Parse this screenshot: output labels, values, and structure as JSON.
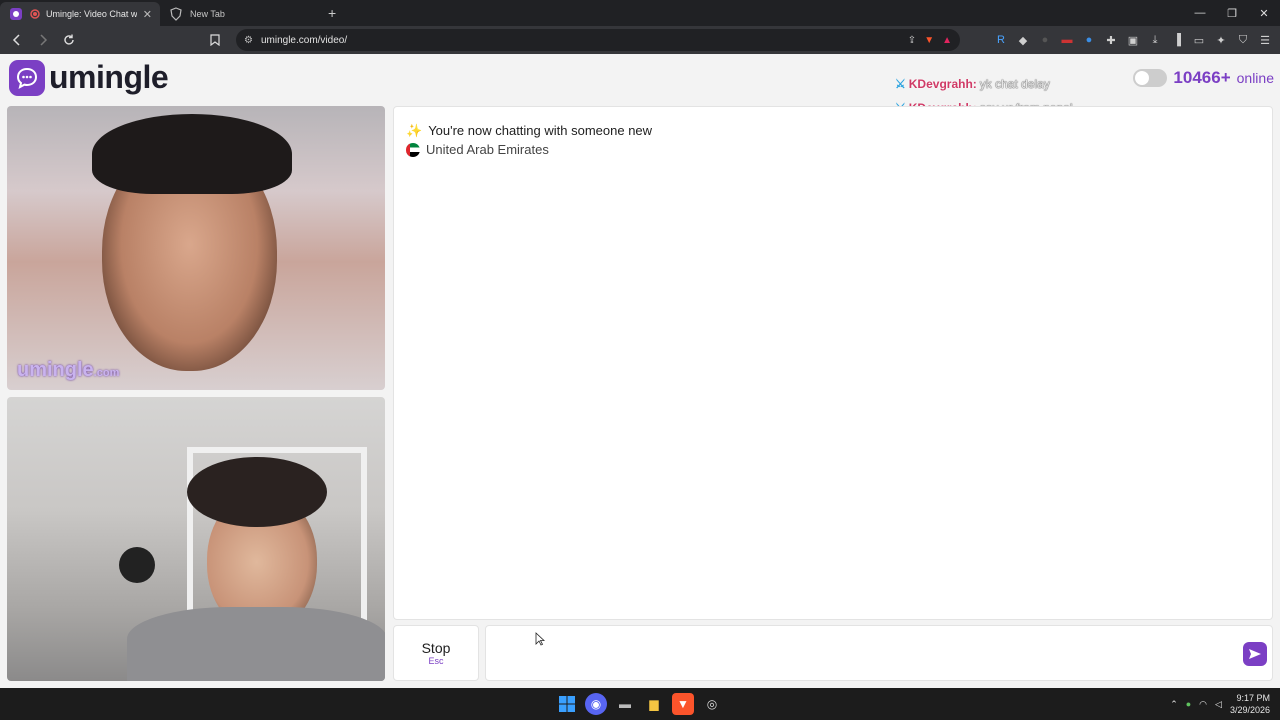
{
  "browser": {
    "tabs": [
      {
        "title": "Umingle: Video Chat with Str",
        "active": true
      },
      {
        "title": "New Tab",
        "active": false
      }
    ],
    "url": "umingle.com/video/"
  },
  "site": {
    "logo_text": "umingle",
    "online_count": "10466+",
    "online_label": "online",
    "brand_color": "#7b3fc4"
  },
  "overlay_chat": [
    {
      "user": "KDevgrahh:",
      "message": "yk chat delay"
    },
    {
      "user": "KDevgrahh:",
      "message": "say ur from nepal"
    }
  ],
  "videos": {
    "stranger_watermark": "umingle",
    "stranger_watermark_suffix": ".com"
  },
  "chat": {
    "status_emoji": "✨",
    "status_text": "You're now chatting with someone new",
    "country": "United Arab Emirates",
    "country_flag": "ae-flag"
  },
  "controls": {
    "stop_label": "Stop",
    "stop_hint": "Esc",
    "message_placeholder": ""
  },
  "taskbar": {
    "time": "9:17 PM",
    "date": "3/29/2026"
  }
}
